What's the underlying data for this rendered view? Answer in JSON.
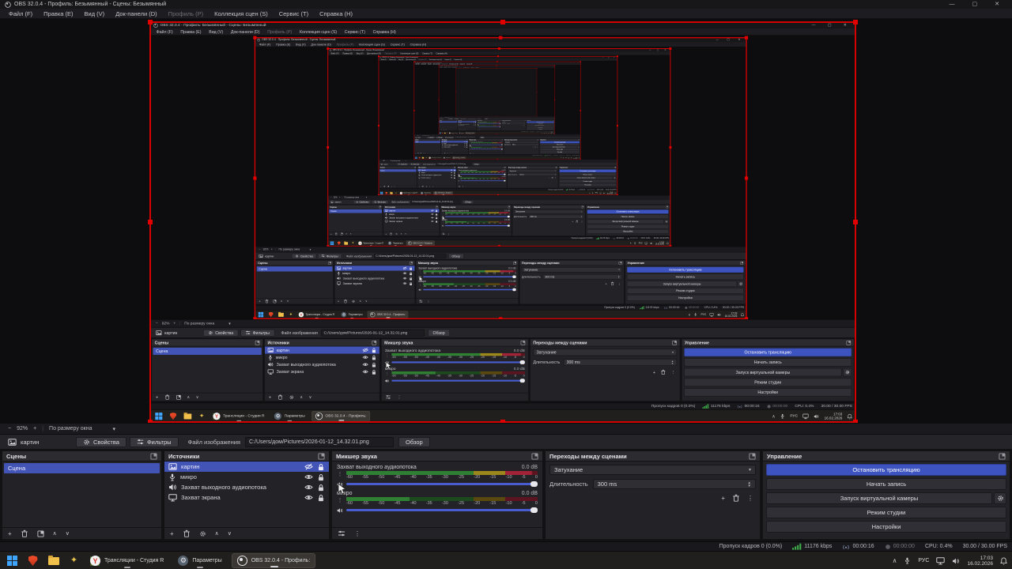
{
  "window": {
    "title": "OBS 32.0.4 - Профиль: Безымянный - Сцены: Безымянный"
  },
  "icons": {
    "min": "—",
    "max": "▢",
    "close": "✕",
    "plus": "+",
    "minus": "−",
    "caret_down": "▾",
    "dots_v": "⋮",
    "up": "∧",
    "down": "∨",
    "chevron_up": "∧",
    "drag_dots": "⋮",
    "spin_up": "▲",
    "spin_down": "▼"
  },
  "menu": {
    "items": [
      {
        "label": "Файл (F)"
      },
      {
        "label": "Правка (E)"
      },
      {
        "label": "Вид (V)"
      },
      {
        "label": "Док-панели (D)"
      },
      {
        "label": "Профиль (P)"
      },
      {
        "label": "Коллекция сцен (S)"
      },
      {
        "label": "Сервис (T)"
      },
      {
        "label": "Справка (H)"
      }
    ]
  },
  "preview": {
    "zoom_level": "92%",
    "fit_mode": "По размеру окна"
  },
  "source_toolbar": {
    "source_name": "картин",
    "properties_label": "Свойства",
    "filters_label": "Фильтры",
    "file_label": "Файл изображения",
    "file_path": "C:/Users/дом/Pictures/2026-01-12_14.32.01.png",
    "browse_label": "Обзор"
  },
  "scenes": {
    "title": "Сцены",
    "items": [
      {
        "label": "Сцена"
      }
    ]
  },
  "sources": {
    "title": "Источники",
    "items": [
      {
        "label": "картин",
        "icon": "image",
        "hidden": true
      },
      {
        "label": "микро",
        "icon": "microphone",
        "hidden": false
      },
      {
        "label": "Захват выходного аудиопотока",
        "icon": "speaker",
        "hidden": false
      },
      {
        "label": "Захват экрана",
        "icon": "monitor",
        "hidden": false
      }
    ]
  },
  "mixer": {
    "title": "Микшер звука",
    "tracks": [
      {
        "name": "Захват выходного аудиопотока",
        "db": "0.0 dB",
        "level_pct": 97
      },
      {
        "name": "микро",
        "db": "0.0 dB",
        "level_pct": 33
      }
    ],
    "ticks": [
      "-60",
      "-55",
      "-50",
      "-45",
      "-40",
      "-35",
      "-30",
      "-25",
      "-20",
      "-15",
      "-10",
      "-5",
      "0"
    ]
  },
  "transitions": {
    "title": "Переходы между сценами",
    "transition": "Затухание",
    "duration_label": "Длительность",
    "duration_value": "300 ms"
  },
  "controls": {
    "title": "Управление",
    "stop_stream": "Остановить трансляцию",
    "start_record": "Начать запись",
    "virtual_cam": "Запуск виртуальной камеры",
    "studio_mode": "Режим студии",
    "settings": "Настройки"
  },
  "statusbar": {
    "dropped_frames": "Пропуск кадров 0 (0.0%)",
    "bitrate": "11176 kbps",
    "stream_time": "00:00:16",
    "record_time": "00:00:00",
    "cpu": "CPU: 0.4%",
    "fps": "30.00 / 30.00 FPS"
  },
  "taskbar": {
    "apps": [
      {
        "label": "Трансляции - Студия R"
      },
      {
        "label": "Параметры"
      },
      {
        "label": "OBS 32.0.4 - Профиль:"
      }
    ],
    "tray": {
      "lang": "РУС",
      "time": "17:03",
      "date": "16.02.2026"
    }
  },
  "colors": {
    "accent_blue": "#3d54c0",
    "selection_blue": "#4254b5",
    "selection_red": "#d40000",
    "meter_green": "#2f8032",
    "meter_yellow": "#9c871d",
    "meter_red": "#a32336",
    "bitrate_green": "#3fae4a"
  },
  "recursion": {
    "depth": 6,
    "scale_x": 0.6969,
    "scale_y": 0.7028
  }
}
